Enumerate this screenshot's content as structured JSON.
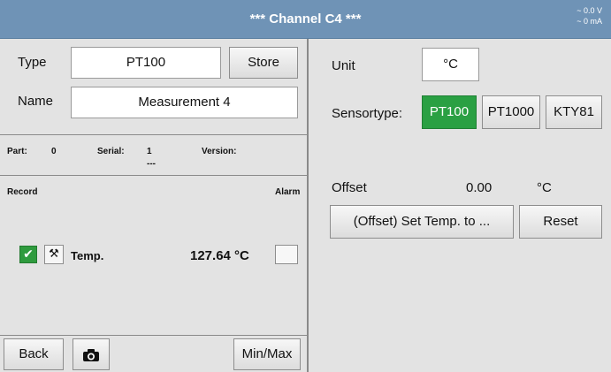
{
  "header": {
    "title": "***  Channel C4  ***",
    "voltage": "~ 0.0 V",
    "current": "~ 0 mA"
  },
  "left": {
    "type_label": "Type",
    "type_value": "PT100",
    "store_label": "Store",
    "name_label": "Name",
    "name_value": "Measurement 4",
    "part_label": "Part:",
    "part_value": "0",
    "serial_label": "Serial:",
    "serial_value": "1",
    "version_label": "Version:",
    "version_value": "---",
    "record_label": "Record",
    "alarm_label": "Alarm",
    "measure_name": "Temp.",
    "measure_value": "127.64 °C",
    "record_checked": "✔",
    "wrench_glyph": "⚒"
  },
  "footer": {
    "back_label": "Back",
    "minmax_label": "Min/Max"
  },
  "right": {
    "unit_label": "Unit",
    "unit_value": "°C",
    "sensortype_label": "Sensortype:",
    "sensor_options": [
      "PT100",
      "PT1000",
      "KTY81"
    ],
    "sensor_selected": "PT100",
    "offset_label": "Offset",
    "offset_value": "0.00",
    "offset_unit": "°C",
    "set_temp_label": "(Offset) Set Temp. to ...",
    "reset_label": "Reset"
  },
  "colors": {
    "header": "#6f93b6",
    "accent_green": "#2aa043"
  }
}
